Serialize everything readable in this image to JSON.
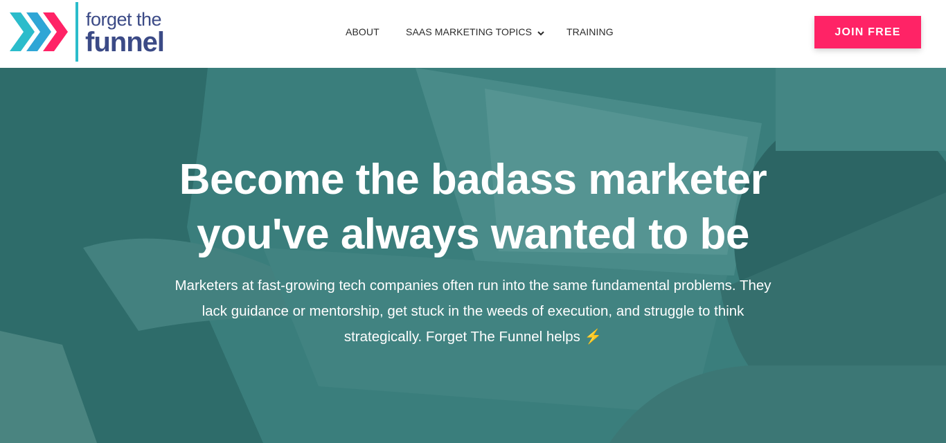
{
  "brand": {
    "line1": "forget the",
    "line2": "funnel",
    "colors": {
      "chevron1": "#2bbccb",
      "chevron2": "#2fa6d6",
      "chevron3": "#ff2366",
      "text": "#3b4a86",
      "divider": "#2bbccb"
    }
  },
  "nav": {
    "items": [
      {
        "label": "ABOUT"
      },
      {
        "label": "SAAS MARKETING TOPICS",
        "icon": "chevron-down-icon"
      },
      {
        "label": "TRAINING"
      }
    ]
  },
  "cta": {
    "label": "JOIN FREE",
    "color": "#ff2366"
  },
  "hero": {
    "headline_line1": "Become the badass marketer",
    "headline_line2": "you've always wanted to be",
    "subtext": "Marketers at fast-growing tech companies often run into the same fundamental problems. They lack guidance or mentorship, get stuck in the weeds of execution, and struggle to think strategically. Forget The Funnel helps",
    "emoji": "⚡",
    "overlay_color": "#2e7876"
  }
}
